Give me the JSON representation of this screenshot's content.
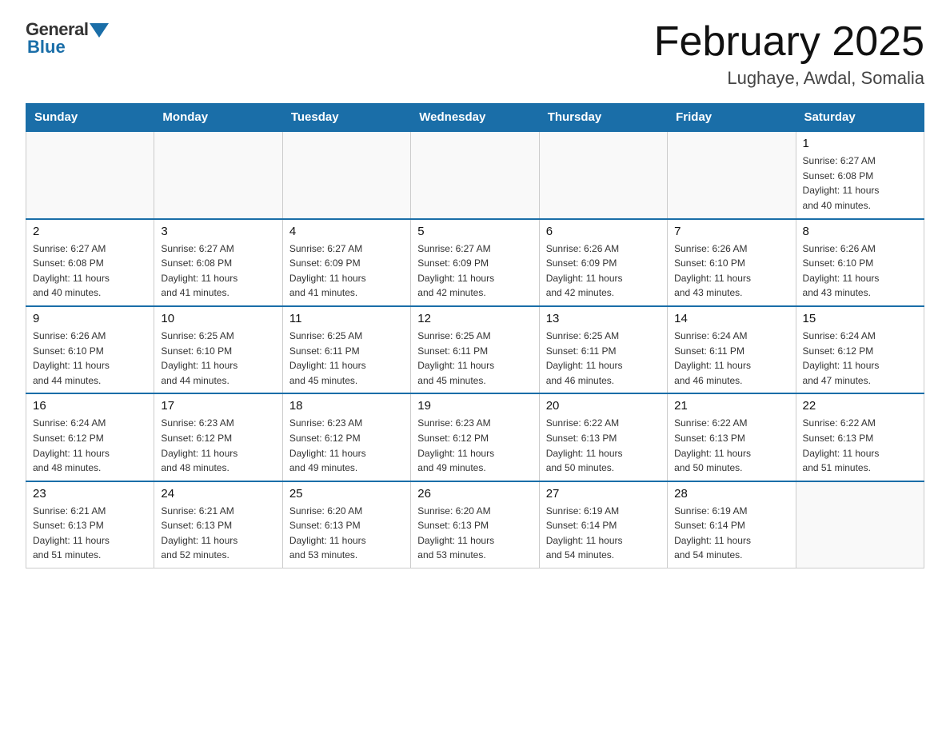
{
  "header": {
    "logo_general": "General",
    "logo_blue": "Blue",
    "title": "February 2025",
    "location": "Lughaye, Awdal, Somalia"
  },
  "weekdays": [
    "Sunday",
    "Monday",
    "Tuesday",
    "Wednesday",
    "Thursday",
    "Friday",
    "Saturday"
  ],
  "weeks": [
    [
      {
        "day": "",
        "info": ""
      },
      {
        "day": "",
        "info": ""
      },
      {
        "day": "",
        "info": ""
      },
      {
        "day": "",
        "info": ""
      },
      {
        "day": "",
        "info": ""
      },
      {
        "day": "",
        "info": ""
      },
      {
        "day": "1",
        "info": "Sunrise: 6:27 AM\nSunset: 6:08 PM\nDaylight: 11 hours\nand 40 minutes."
      }
    ],
    [
      {
        "day": "2",
        "info": "Sunrise: 6:27 AM\nSunset: 6:08 PM\nDaylight: 11 hours\nand 40 minutes."
      },
      {
        "day": "3",
        "info": "Sunrise: 6:27 AM\nSunset: 6:08 PM\nDaylight: 11 hours\nand 41 minutes."
      },
      {
        "day": "4",
        "info": "Sunrise: 6:27 AM\nSunset: 6:09 PM\nDaylight: 11 hours\nand 41 minutes."
      },
      {
        "day": "5",
        "info": "Sunrise: 6:27 AM\nSunset: 6:09 PM\nDaylight: 11 hours\nand 42 minutes."
      },
      {
        "day": "6",
        "info": "Sunrise: 6:26 AM\nSunset: 6:09 PM\nDaylight: 11 hours\nand 42 minutes."
      },
      {
        "day": "7",
        "info": "Sunrise: 6:26 AM\nSunset: 6:10 PM\nDaylight: 11 hours\nand 43 minutes."
      },
      {
        "day": "8",
        "info": "Sunrise: 6:26 AM\nSunset: 6:10 PM\nDaylight: 11 hours\nand 43 minutes."
      }
    ],
    [
      {
        "day": "9",
        "info": "Sunrise: 6:26 AM\nSunset: 6:10 PM\nDaylight: 11 hours\nand 44 minutes."
      },
      {
        "day": "10",
        "info": "Sunrise: 6:25 AM\nSunset: 6:10 PM\nDaylight: 11 hours\nand 44 minutes."
      },
      {
        "day": "11",
        "info": "Sunrise: 6:25 AM\nSunset: 6:11 PM\nDaylight: 11 hours\nand 45 minutes."
      },
      {
        "day": "12",
        "info": "Sunrise: 6:25 AM\nSunset: 6:11 PM\nDaylight: 11 hours\nand 45 minutes."
      },
      {
        "day": "13",
        "info": "Sunrise: 6:25 AM\nSunset: 6:11 PM\nDaylight: 11 hours\nand 46 minutes."
      },
      {
        "day": "14",
        "info": "Sunrise: 6:24 AM\nSunset: 6:11 PM\nDaylight: 11 hours\nand 46 minutes."
      },
      {
        "day": "15",
        "info": "Sunrise: 6:24 AM\nSunset: 6:12 PM\nDaylight: 11 hours\nand 47 minutes."
      }
    ],
    [
      {
        "day": "16",
        "info": "Sunrise: 6:24 AM\nSunset: 6:12 PM\nDaylight: 11 hours\nand 48 minutes."
      },
      {
        "day": "17",
        "info": "Sunrise: 6:23 AM\nSunset: 6:12 PM\nDaylight: 11 hours\nand 48 minutes."
      },
      {
        "day": "18",
        "info": "Sunrise: 6:23 AM\nSunset: 6:12 PM\nDaylight: 11 hours\nand 49 minutes."
      },
      {
        "day": "19",
        "info": "Sunrise: 6:23 AM\nSunset: 6:12 PM\nDaylight: 11 hours\nand 49 minutes."
      },
      {
        "day": "20",
        "info": "Sunrise: 6:22 AM\nSunset: 6:13 PM\nDaylight: 11 hours\nand 50 minutes."
      },
      {
        "day": "21",
        "info": "Sunrise: 6:22 AM\nSunset: 6:13 PM\nDaylight: 11 hours\nand 50 minutes."
      },
      {
        "day": "22",
        "info": "Sunrise: 6:22 AM\nSunset: 6:13 PM\nDaylight: 11 hours\nand 51 minutes."
      }
    ],
    [
      {
        "day": "23",
        "info": "Sunrise: 6:21 AM\nSunset: 6:13 PM\nDaylight: 11 hours\nand 51 minutes."
      },
      {
        "day": "24",
        "info": "Sunrise: 6:21 AM\nSunset: 6:13 PM\nDaylight: 11 hours\nand 52 minutes."
      },
      {
        "day": "25",
        "info": "Sunrise: 6:20 AM\nSunset: 6:13 PM\nDaylight: 11 hours\nand 53 minutes."
      },
      {
        "day": "26",
        "info": "Sunrise: 6:20 AM\nSunset: 6:13 PM\nDaylight: 11 hours\nand 53 minutes."
      },
      {
        "day": "27",
        "info": "Sunrise: 6:19 AM\nSunset: 6:14 PM\nDaylight: 11 hours\nand 54 minutes."
      },
      {
        "day": "28",
        "info": "Sunrise: 6:19 AM\nSunset: 6:14 PM\nDaylight: 11 hours\nand 54 minutes."
      },
      {
        "day": "",
        "info": ""
      }
    ]
  ]
}
